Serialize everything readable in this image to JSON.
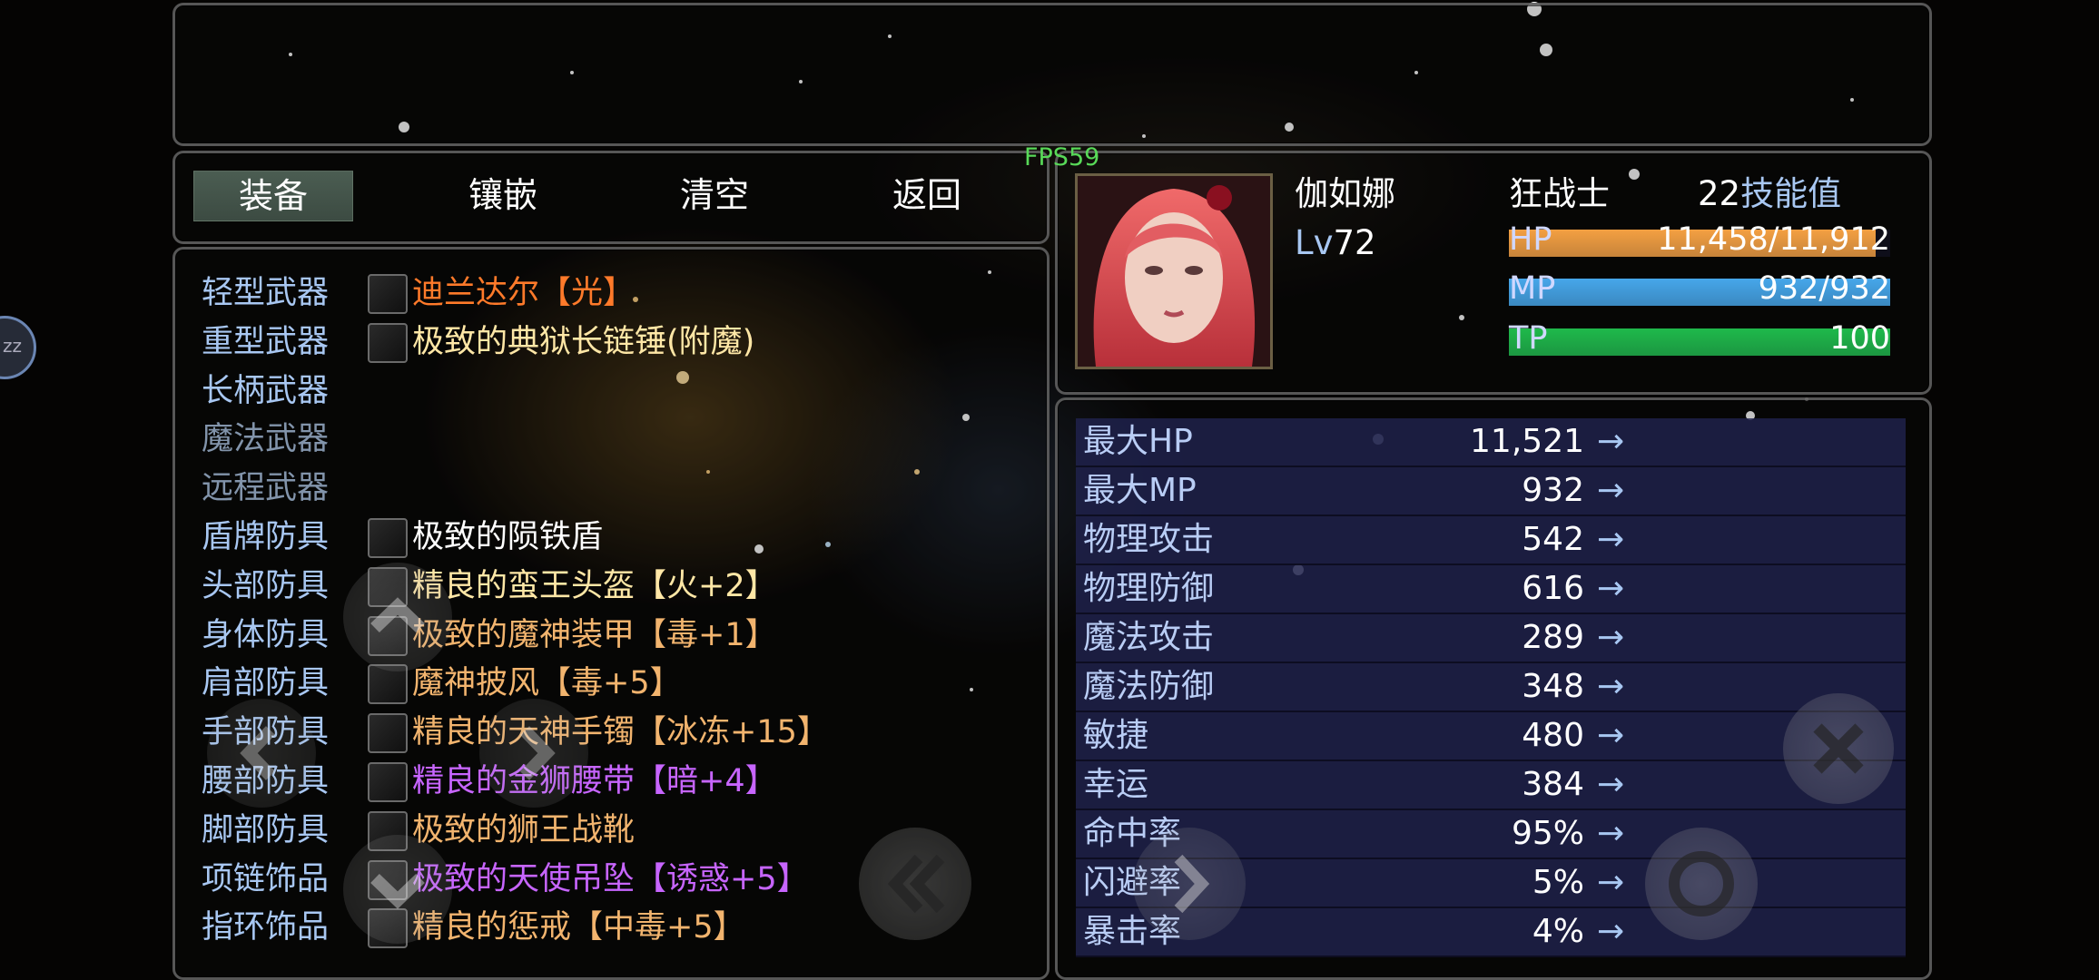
{
  "fps": "FPS59",
  "menu": {
    "equip": "装备",
    "inlay": "镶嵌",
    "clear": "清空",
    "back": "返回"
  },
  "colors": {
    "label": "#a8c7f2",
    "label_dim": "#8294ab",
    "orange": "#ff7a2a",
    "gold": "#ffe7a6",
    "white": "#ffffff",
    "purple": "#c765ff",
    "tan": "#f2b46e",
    "hp_bar": "#f4a042",
    "mp_bar": "#46a7ea",
    "tp_bar": "#1fb94b"
  },
  "equipment": [
    {
      "slot": "轻型武器",
      "item": "迪兰达尔【光】",
      "icon": "sword-icon",
      "color": "#ff7a2a"
    },
    {
      "slot": "重型武器",
      "item": "极致的典狱长链锤(附魔)",
      "icon": "flail-icon",
      "color": "#ffe7a6"
    },
    {
      "slot": "长柄武器",
      "item": "",
      "icon": "",
      "color": ""
    },
    {
      "slot": "魔法武器",
      "item": "",
      "icon": "",
      "color": ""
    },
    {
      "slot": "远程武器",
      "item": "",
      "icon": "",
      "color": ""
    },
    {
      "slot": "盾牌防具",
      "item": "极致的陨铁盾",
      "icon": "shield-icon",
      "color": "#ffffff"
    },
    {
      "slot": "头部防具",
      "item": "精良的蛮王头盔【火+2】",
      "icon": "helmet-icon",
      "color": "#ffe7a6"
    },
    {
      "slot": "身体防具",
      "item": "极致的魔神装甲【毒+1】",
      "icon": "armor-icon",
      "color": "#f2b46e"
    },
    {
      "slot": "肩部防具",
      "item": "魔神披风【毒+5】",
      "icon": "cloak-icon",
      "color": "#f2b46e"
    },
    {
      "slot": "手部防具",
      "item": "精良的天神手镯【冰冻+15】",
      "icon": "bracelet-icon",
      "color": "#f2b46e"
    },
    {
      "slot": "腰部防具",
      "item": "精良的金狮腰带【暗+4】",
      "icon": "belt-icon",
      "color": "#c765ff"
    },
    {
      "slot": "脚部防具",
      "item": "极致的狮王战靴",
      "icon": "boots-icon",
      "color": "#f2b46e"
    },
    {
      "slot": "项链饰品",
      "item": "极致的天使吊坠【诱惑+5】",
      "icon": "pendant-icon",
      "color": "#c765ff"
    },
    {
      "slot": "指环饰品",
      "item": "精良的惩戒【中毒+5】",
      "icon": "ring-icon",
      "color": "#f2b46e"
    }
  ],
  "character": {
    "name": "伽如娜",
    "level_prefix": "Lv",
    "level": "72",
    "class": "狂战士",
    "skill_points": "22",
    "skill_points_label": "技能值",
    "hp_label": "HP",
    "hp_value": "11,458/11,912",
    "hp_fraction": 0.962,
    "mp_label": "MP",
    "mp_value": "932/932",
    "mp_fraction": 1.0,
    "tp_label": "TP",
    "tp_value": "100",
    "tp_fraction": 1.0
  },
  "stats": [
    {
      "label": "最大HP",
      "value": "11,521",
      "arrow": "→"
    },
    {
      "label": "最大MP",
      "value": "932",
      "arrow": "→"
    },
    {
      "label": "物理攻击",
      "value": "542",
      "arrow": "→"
    },
    {
      "label": "物理防御",
      "value": "616",
      "arrow": "→"
    },
    {
      "label": "魔法攻击",
      "value": "289",
      "arrow": "→"
    },
    {
      "label": "魔法防御",
      "value": "348",
      "arrow": "→"
    },
    {
      "label": "敏捷",
      "value": "480",
      "arrow": "→"
    },
    {
      "label": "幸运",
      "value": "384",
      "arrow": "→"
    },
    {
      "label": "命中率",
      "value": "95%",
      "arrow": "→"
    },
    {
      "label": "闪避率",
      "value": "5%",
      "arrow": "→"
    },
    {
      "label": "暴击率",
      "value": "4%",
      "arrow": "→"
    }
  ],
  "side_tab": "zz"
}
